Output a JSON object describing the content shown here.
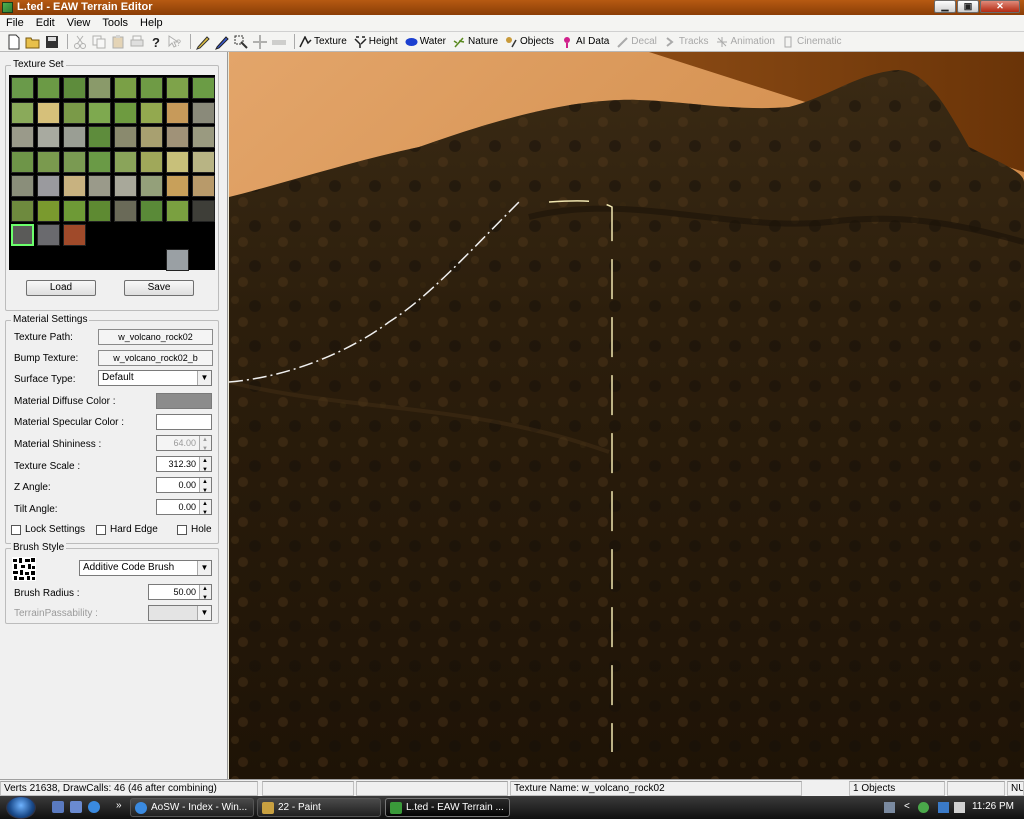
{
  "window": {
    "title": "L.ted - EAW Terrain Editor",
    "minimize": "▁",
    "maximize": "▣",
    "close": "✕"
  },
  "menu": [
    "File",
    "Edit",
    "View",
    "Tools",
    "Help"
  ],
  "toolbar": {
    "file_icons": [
      "new-file-icon",
      "open-folder-icon",
      "save-disk-icon",
      "cut-icon",
      "copy-icon",
      "paste-icon",
      "print-icon",
      "help-icon",
      "context-help-icon"
    ],
    "tool_icons": [
      "pencil-icon",
      "pen-icon",
      "select-icon",
      "move-icon",
      "eraser-icon"
    ],
    "modes": [
      {
        "label": "Texture",
        "icon": "texture-icon",
        "enabled": true
      },
      {
        "label": "Height",
        "icon": "height-icon",
        "enabled": true
      },
      {
        "label": "Water",
        "icon": "water-icon",
        "enabled": true
      },
      {
        "label": "Nature",
        "icon": "nature-icon",
        "enabled": true
      },
      {
        "label": "Objects",
        "icon": "objects-icon",
        "enabled": true
      },
      {
        "label": "AI Data",
        "icon": "ai-data-icon",
        "enabled": true
      },
      {
        "label": "Decal",
        "icon": "decal-icon",
        "enabled": false
      },
      {
        "label": "Tracks",
        "icon": "tracks-icon",
        "enabled": false
      },
      {
        "label": "Animation",
        "icon": "animation-icon",
        "enabled": false
      },
      {
        "label": "Cinematic",
        "icon": "cinematic-icon",
        "enabled": false
      }
    ]
  },
  "texture_set": {
    "title": "Texture Set",
    "swatch_colors": [
      [
        "#6a9a4a",
        "#6b9a45",
        "#5e8c3c",
        "#8a9a6a",
        "#7aa046",
        "#6f9b45",
        "#7ea34a",
        "#6b9c45"
      ],
      [
        "#8aaa5a",
        "#d6c07a",
        "#7a9a48",
        "#7ea94f",
        "#6e9b40",
        "#93a94f",
        "#c79a5a",
        "#8a8a7a"
      ],
      [
        "#9a9a8a",
        "#a8aaa0",
        "#9a9e94",
        "#5e8c3c",
        "#8a8a6e",
        "#a8a070",
        "#a09278",
        "#9a9a80"
      ],
      [
        "#6e9548",
        "#7a9a4e",
        "#7a9a52",
        "#6a9a46",
        "#8aa45a",
        "#a0a85a",
        "#c8c07a",
        "#b8b484"
      ],
      [
        "#8a8e7a",
        "#9a9a9e",
        "#c8b280",
        "#9a9a8a",
        "#a8a89a",
        "#94a07a",
        "#c8a05a",
        "#b89a6a"
      ],
      [
        "#6e8a3e",
        "#7a9a2e",
        "#6e9a36",
        "#5e8a32",
        "#6a6a58",
        "#5a8a38",
        "#7aa040",
        "#3e3e38"
      ],
      [
        "#5a5a58",
        "#6a6a6e",
        "#a04a2a"
      ],
      [
        "#9aa0a4"
      ]
    ],
    "load_label": "Load",
    "save_label": "Save"
  },
  "material": {
    "title": "Material Settings",
    "texture_path_label": "Texture Path:",
    "texture_path": "w_volcano_rock02",
    "bump_texture_label": "Bump Texture:",
    "bump_texture": "w_volcano_rock02_b",
    "surface_type_label": "Surface Type:",
    "surface_type": "Default",
    "diffuse_label": "Material Diffuse Color :",
    "diffuse_color": "#8c8c8c",
    "specular_label": "Material Specular Color :",
    "specular_color": "#ffffff",
    "shininess_label": "Material Shininess :",
    "shininess": "64.00",
    "texture_scale_label": "Texture Scale :",
    "texture_scale": "312.30",
    "z_angle_label": "Z Angle:",
    "z_angle": "0.00",
    "tilt_angle_label": "Tilt Angle:",
    "tilt_angle": "0.00",
    "lock_settings_label": "Lock Settings",
    "hard_edge_label": "Hard Edge",
    "hole_label": "Hole"
  },
  "brush": {
    "title": "Brush Style",
    "brush_type": "Additive Code Brush",
    "radius_label": "Brush Radius :",
    "radius": "50.00",
    "passability_label": "TerrainPassability :",
    "passability": ""
  },
  "status": {
    "stats": "Verts 21638, DrawCalls: 46 (46 after combining)",
    "texture_name": "Texture Name: w_volcano_rock02",
    "objects": "1 Objects",
    "num": "NU"
  },
  "taskbar": {
    "tasks": [
      {
        "label": "AoSW - Index - Win...",
        "icon": "ie-icon",
        "active": false
      },
      {
        "label": "22 - Paint",
        "icon": "paint-icon",
        "active": false
      },
      {
        "label": "L.ted - EAW Terrain ...",
        "icon": "terrain-editor-icon",
        "active": true
      }
    ],
    "overflow": "»",
    "tray_arrow": "<",
    "clock": "11:26 PM"
  }
}
